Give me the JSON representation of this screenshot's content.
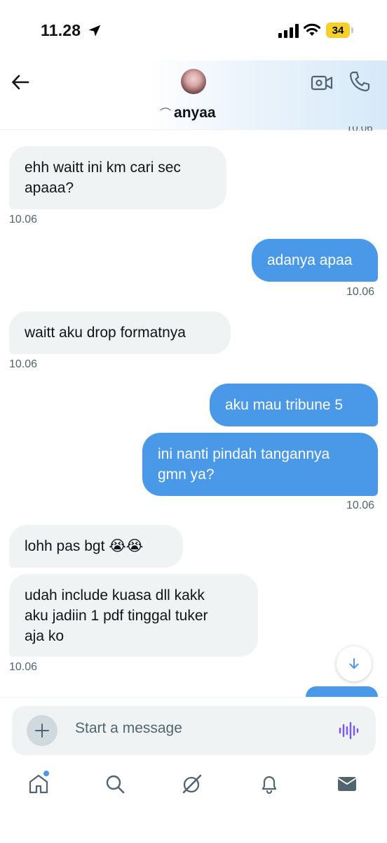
{
  "status_bar": {
    "time": "11.28",
    "battery": "34"
  },
  "header": {
    "contact_name": "anyaa",
    "name_deco": "⌒"
  },
  "peek_time": "10.06",
  "messages": [
    {
      "dir": "received",
      "text": "ehh waitt ini km cari sec\napaaa?",
      "time": "10.06"
    },
    {
      "dir": "sent",
      "text": "adanya apaa",
      "time": "10.06"
    },
    {
      "dir": "received",
      "text": "waitt aku drop formatnya",
      "time": "10.06"
    },
    {
      "dir": "sent",
      "text": "aku mau tribune 5",
      "time": ""
    },
    {
      "dir": "sent",
      "text": "ini nanti pindah tangannya\ngmn ya?",
      "time": "10.06"
    },
    {
      "dir": "received",
      "text": "lohh pas bgt 😭😭",
      "time": ""
    },
    {
      "dir": "received",
      "text": "udah include kuasa dll kakk\naku jadiin 1 pdf tinggal tuker\naja ko",
      "time": "10.06"
    }
  ],
  "composer": {
    "placeholder": "Start a message"
  },
  "nav": {
    "items": [
      "home-icon",
      "search-icon",
      "grok-icon",
      "notifications-icon",
      "messages-icon"
    ]
  },
  "colors": {
    "sent_bubble": "#4a99e9",
    "received_bubble": "#eff3f4",
    "voice_accent": "#7856ff"
  }
}
